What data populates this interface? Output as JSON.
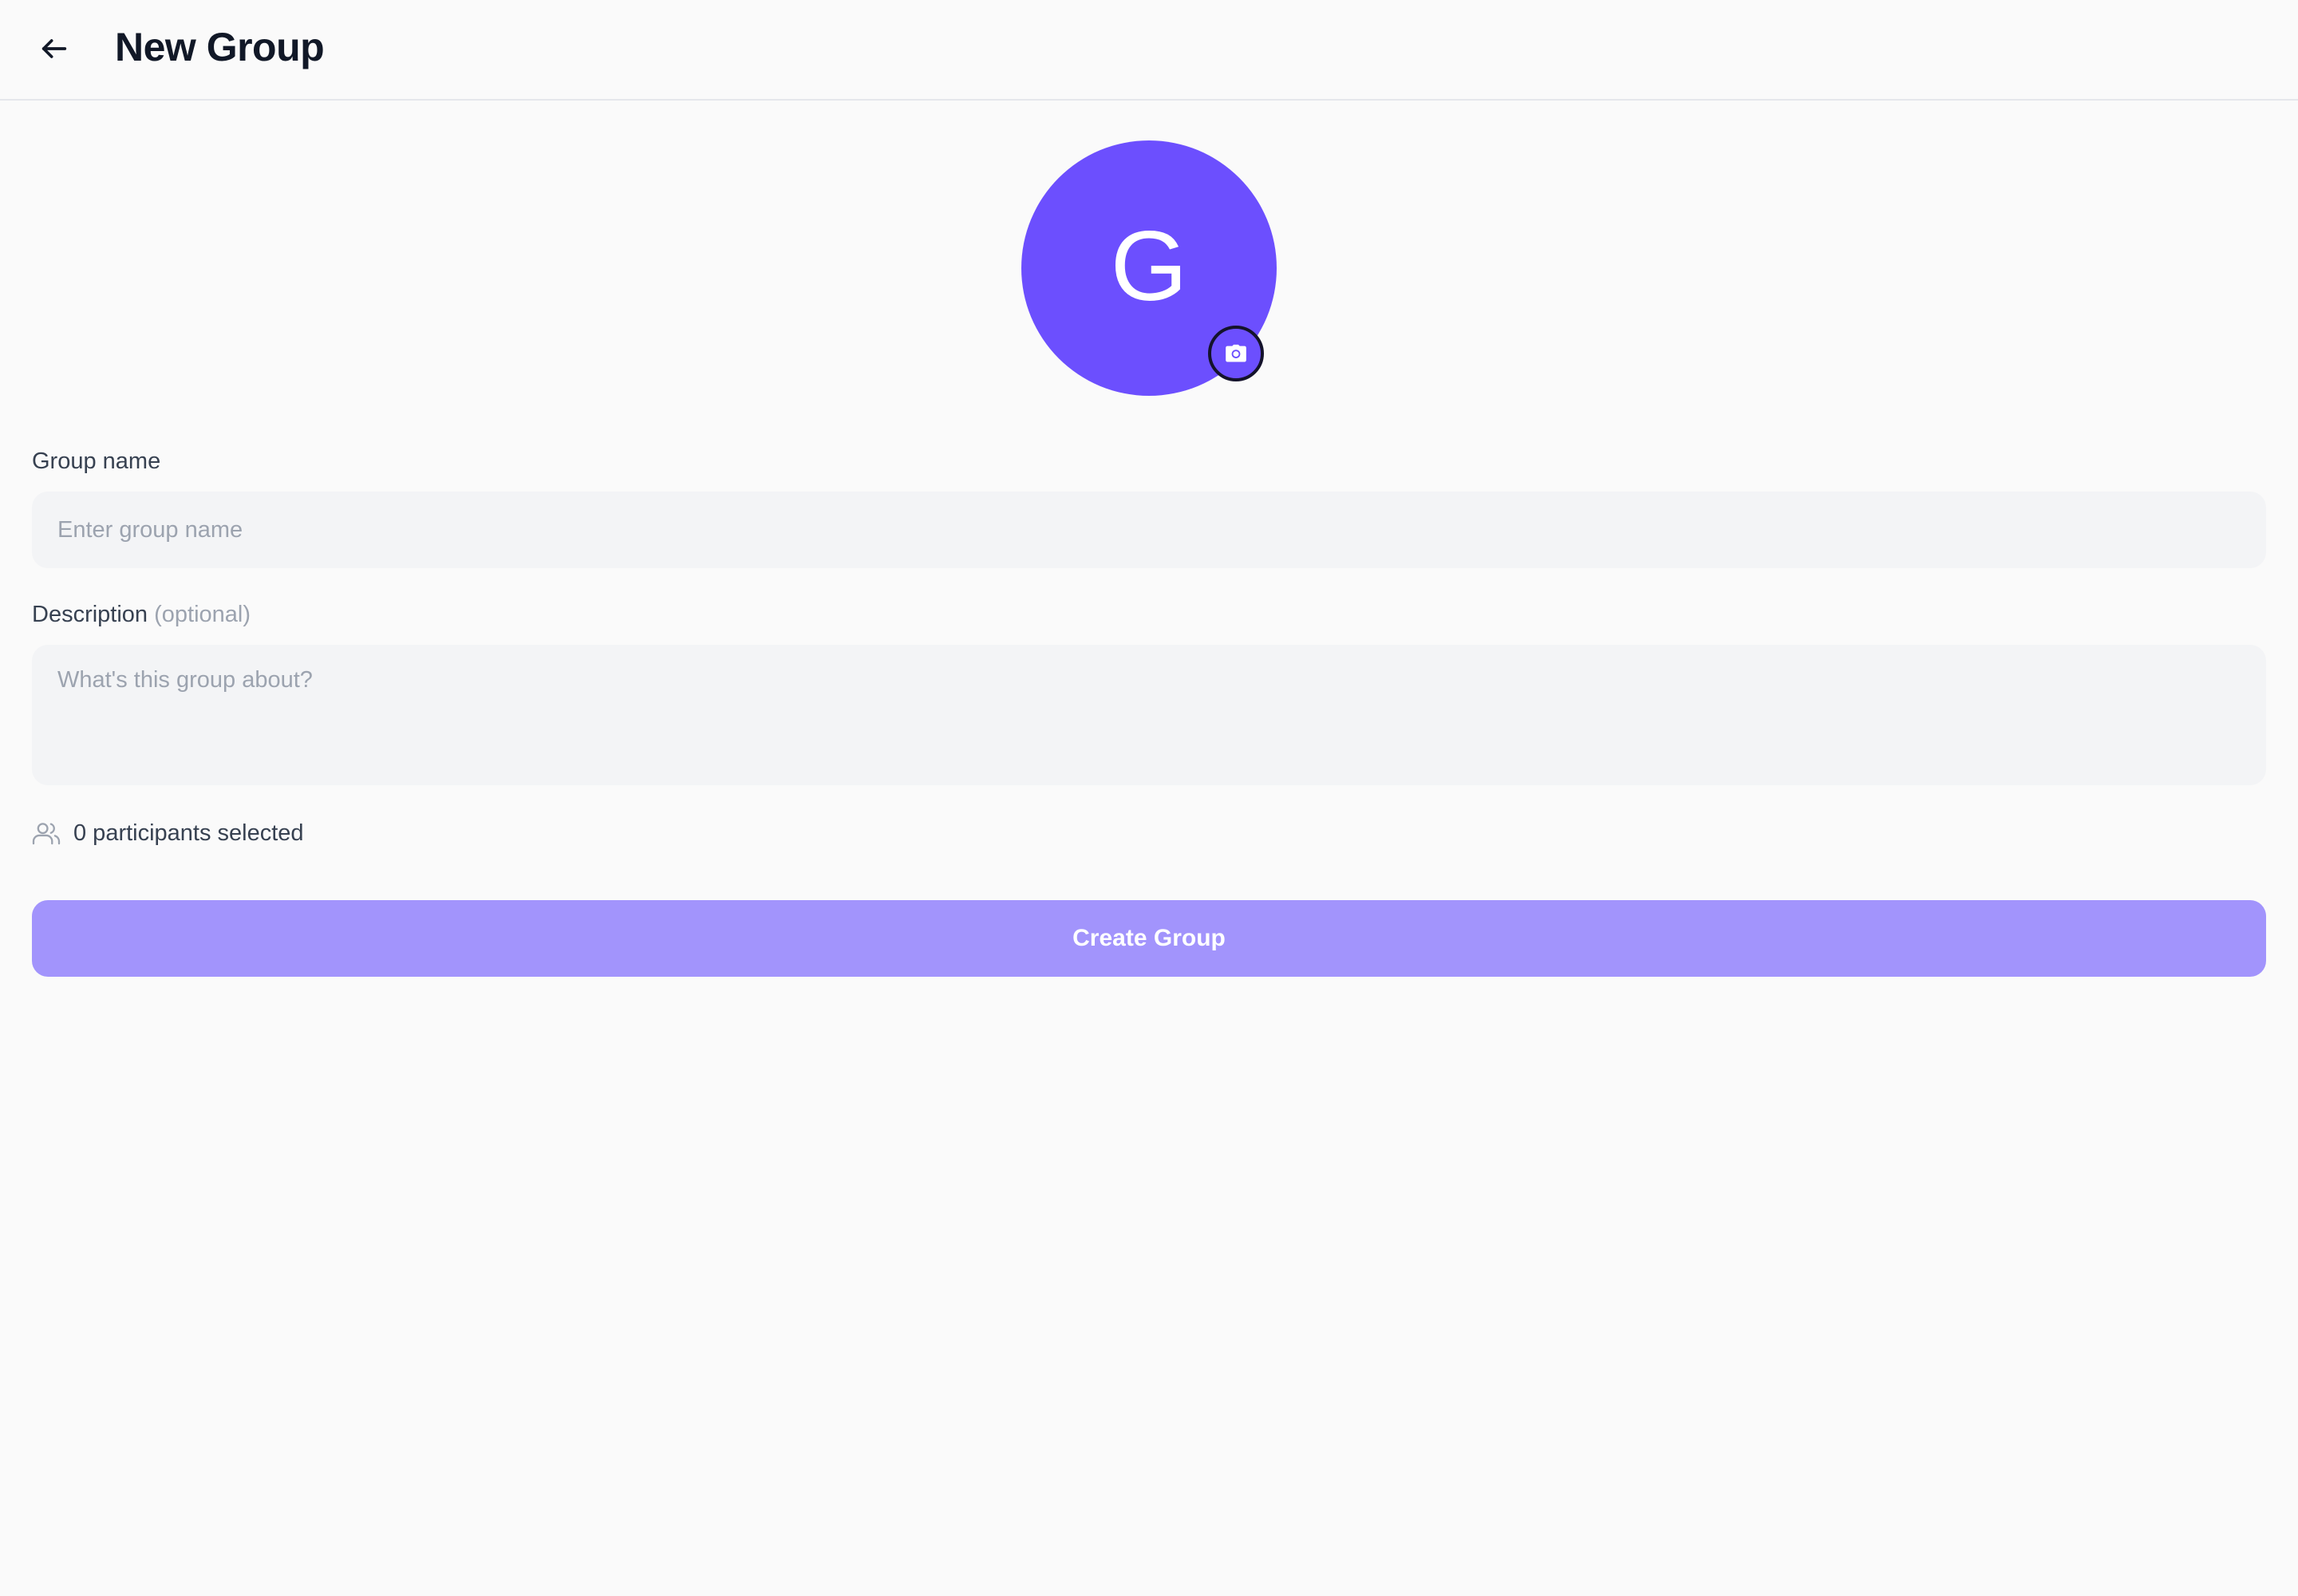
{
  "header": {
    "title": "New Group",
    "back_icon": "arrow-left-icon"
  },
  "avatar": {
    "initial": "G",
    "color": "#6c4ffe",
    "camera_icon": "camera-icon"
  },
  "form": {
    "group_name": {
      "label": "Group name",
      "placeholder": "Enter group name",
      "value": ""
    },
    "description": {
      "label": "Description",
      "optional_label": "(optional)",
      "placeholder": "What's this group about?",
      "value": ""
    }
  },
  "participants": {
    "icon": "users-icon",
    "text": "0 participants selected"
  },
  "actions": {
    "create_label": "Create Group",
    "create_color": "#a294fc"
  }
}
